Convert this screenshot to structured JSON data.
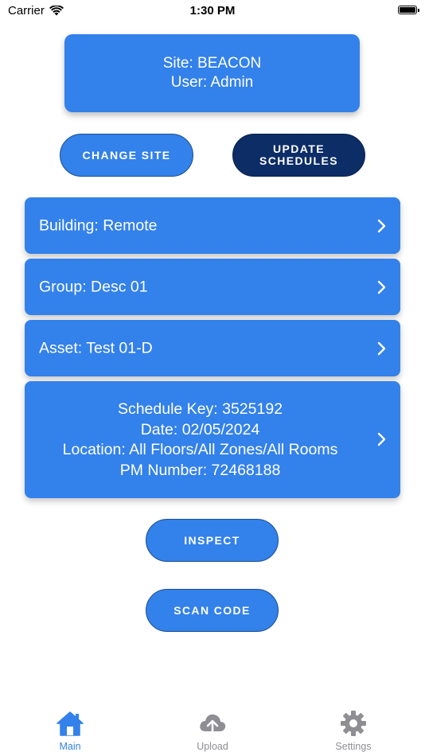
{
  "status_bar": {
    "carrier": "Carrier",
    "time": "1:30 PM"
  },
  "info_card": {
    "site_line": "Site: BEACON",
    "user_line": "User: Admin"
  },
  "buttons": {
    "change_site": "CHANGE SITE",
    "update_schedules_line1": "UPDATE",
    "update_schedules_line2": "SCHEDULES",
    "inspect": "INSPECT",
    "scan_code": "SCAN CODE"
  },
  "rows": {
    "building": "Building: Remote",
    "group": "Group: Desc 01",
    "asset": "Asset: Test 01-D"
  },
  "schedule": {
    "key": "Schedule Key: 3525192",
    "date": "Date: 02/05/2024",
    "location": "Location: All Floors/All Zones/All Rooms",
    "pm_number": "PM Number: 72468188"
  },
  "tabs": [
    {
      "label": "Main",
      "icon": "home-icon",
      "active": true
    },
    {
      "label": "Upload",
      "icon": "cloud-upload-icon",
      "active": false
    },
    {
      "label": "Settings",
      "icon": "gear-icon",
      "active": false
    }
  ],
  "colors": {
    "primary": "#3381ea",
    "dark_button": "#0c2d66",
    "tab_active": "#3381ea",
    "tab_inactive": "#8e8e93"
  }
}
